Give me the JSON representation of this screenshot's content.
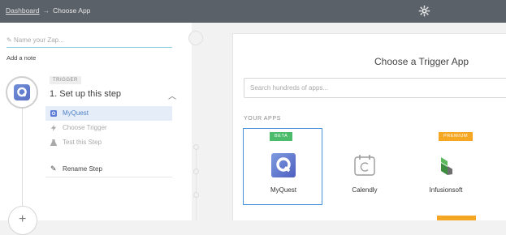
{
  "topbar": {
    "breadcrumb": {
      "root": "Dashboard",
      "separator": "→",
      "current": "Choose App"
    },
    "settings_icon": "gear-icon"
  },
  "editor": {
    "zap_name_placeholder": "Name your Zap...",
    "add_note": "Add a note",
    "step": {
      "badge": "TRIGGER",
      "title": "1. Set up this step",
      "items": [
        {
          "label": "MyQuest",
          "icon": "myquest-icon",
          "state": "active"
        },
        {
          "label": "Choose Trigger",
          "icon": "bolt-icon",
          "state": "muted"
        },
        {
          "label": "Test this Step",
          "icon": "flask-icon",
          "state": "muted"
        }
      ],
      "rename": "Rename Step"
    }
  },
  "chooser": {
    "title": "Choose a Trigger App",
    "search_placeholder": "Search hundreds of apps...",
    "section_label": "YOUR APPS",
    "apps": [
      {
        "name": "MyQuest",
        "tag": "BETA",
        "tag_color": "#4cbb6c",
        "selected": true
      },
      {
        "name": "Calendly",
        "tag": "",
        "selected": false
      },
      {
        "name": "Infusionsoft",
        "tag": "PREMIUM",
        "tag_color": "#f5a623",
        "selected": false
      }
    ]
  },
  "colors": {
    "topbar": "#5b6168",
    "accent": "#4a90d9",
    "beta": "#4cbb6c",
    "premium": "#f5a623"
  }
}
